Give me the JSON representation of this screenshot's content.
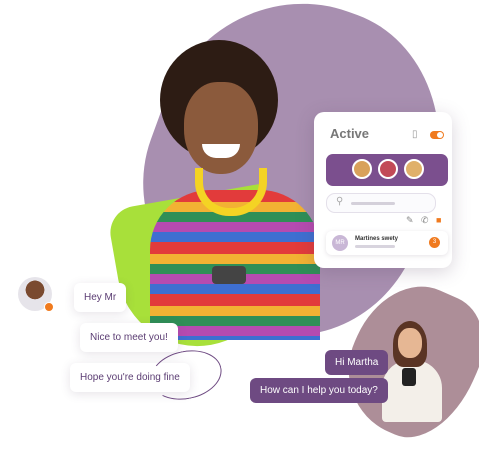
{
  "card": {
    "title": "Active",
    "icons": [
      "video-icon",
      "toggle-switch"
    ],
    "row_icons": [
      "edit-icon",
      "phone-icon",
      "bell-icon"
    ],
    "chat": {
      "avatar_initials": "MR",
      "name": "Martines swety",
      "unread": "3"
    }
  },
  "chat_left": {
    "messages": [
      "Hey Mr",
      "Nice to meet you!",
      "Hope you're doing fine"
    ]
  },
  "chat_right": {
    "messages": [
      "Hi Martha",
      "How can I help you today?"
    ]
  },
  "colors": {
    "brand_purple": "#6e4a82",
    "accent_orange": "#f07a1e",
    "lime": "#a8e03a",
    "blob_purple": "#a88fb0",
    "blob_mauve": "#ad8e98"
  }
}
